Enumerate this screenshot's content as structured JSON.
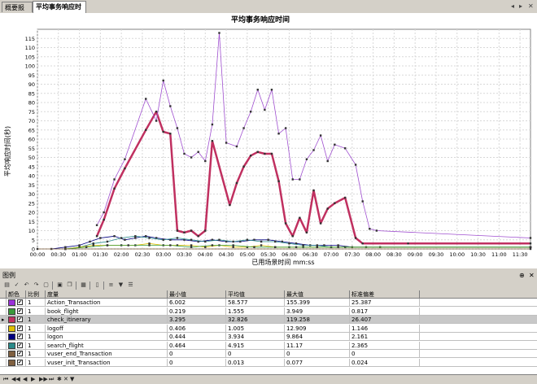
{
  "tabs": [
    {
      "label": "概要报告",
      "active": false
    },
    {
      "label": "平均事务响应时间",
      "active": true
    }
  ],
  "chart_data": {
    "type": "line",
    "title": "平均事务响应时间",
    "xlabel": "已用场景时间 mm:ss",
    "ylabel": "平均响应时间(秒)",
    "ylim": [
      0,
      120
    ],
    "xlim": [
      0,
      705
    ],
    "yticks": [
      0,
      5,
      10,
      15,
      20,
      25,
      30,
      35,
      40,
      45,
      50,
      55,
      60,
      65,
      70,
      75,
      80,
      85,
      90,
      95,
      100,
      105,
      110,
      115
    ],
    "xticks": [
      "00:00",
      "00:30",
      "01:00",
      "01:30",
      "02:00",
      "02:30",
      "03:00",
      "03:30",
      "04:00",
      "04:30",
      "05:00",
      "05:30",
      "06:00",
      "06:30",
      "07:00",
      "07:30",
      "08:00",
      "08:30",
      "09:00",
      "09:30",
      "10:00",
      "10:30",
      "11:00",
      "11:30"
    ],
    "grid": true,
    "series": [
      {
        "name": "check_itinerary",
        "color": "#c03060",
        "width": 2.5,
        "points": [
          [
            85,
            7
          ],
          [
            95,
            16
          ],
          [
            110,
            33
          ],
          [
            125,
            44
          ],
          [
            155,
            65
          ],
          [
            170,
            75
          ],
          [
            180,
            64
          ],
          [
            190,
            63
          ],
          [
            200,
            10
          ],
          [
            210,
            9
          ],
          [
            220,
            10
          ],
          [
            230,
            7
          ],
          [
            240,
            10
          ],
          [
            250,
            59
          ],
          [
            275,
            24
          ],
          [
            285,
            36
          ],
          [
            295,
            45
          ],
          [
            305,
            51
          ],
          [
            315,
            53
          ],
          [
            325,
            52
          ],
          [
            335,
            52
          ],
          [
            345,
            37
          ],
          [
            355,
            14
          ],
          [
            365,
            7
          ],
          [
            375,
            17
          ],
          [
            385,
            9
          ],
          [
            395,
            32
          ],
          [
            405,
            14
          ],
          [
            415,
            22
          ],
          [
            425,
            25
          ],
          [
            440,
            28
          ],
          [
            455,
            6
          ],
          [
            465,
            3
          ],
          [
            530,
            3
          ],
          [
            705,
            3
          ]
        ]
      },
      {
        "name": "Action_Transaction",
        "color": "#a050d0",
        "width": 0.8,
        "points": [
          [
            85,
            13
          ],
          [
            95,
            20
          ],
          [
            110,
            38
          ],
          [
            125,
            49
          ],
          [
            155,
            82
          ],
          [
            170,
            70
          ],
          [
            180,
            92
          ],
          [
            190,
            78
          ],
          [
            200,
            66
          ],
          [
            210,
            52
          ],
          [
            220,
            50
          ],
          [
            230,
            53
          ],
          [
            240,
            48
          ],
          [
            250,
            68
          ],
          [
            260,
            118
          ],
          [
            270,
            58
          ],
          [
            285,
            56
          ],
          [
            295,
            66
          ],
          [
            305,
            75
          ],
          [
            315,
            87
          ],
          [
            325,
            76
          ],
          [
            335,
            87
          ],
          [
            345,
            63
          ],
          [
            355,
            66
          ],
          [
            365,
            38
          ],
          [
            375,
            38
          ],
          [
            385,
            49
          ],
          [
            395,
            54
          ],
          [
            405,
            62
          ],
          [
            415,
            48
          ],
          [
            425,
            57
          ],
          [
            440,
            55
          ],
          [
            455,
            46
          ],
          [
            465,
            26
          ],
          [
            475,
            11
          ],
          [
            485,
            10
          ],
          [
            705,
            6
          ]
        ]
      },
      {
        "name": "logon",
        "color": "#000080",
        "width": 0.8,
        "points": [
          [
            20,
            0
          ],
          [
            40,
            1
          ],
          [
            60,
            2
          ],
          [
            75,
            4
          ],
          [
            90,
            6
          ],
          [
            110,
            7
          ],
          [
            125,
            5
          ],
          [
            140,
            6
          ],
          [
            155,
            7
          ],
          [
            170,
            6
          ],
          [
            190,
            5
          ],
          [
            210,
            5
          ],
          [
            230,
            4
          ],
          [
            250,
            5
          ],
          [
            270,
            4
          ],
          [
            290,
            4
          ],
          [
            310,
            5
          ],
          [
            330,
            5
          ],
          [
            350,
            4
          ],
          [
            370,
            3
          ],
          [
            390,
            2
          ],
          [
            410,
            2
          ],
          [
            430,
            2
          ],
          [
            450,
            1
          ],
          [
            470,
            1
          ],
          [
            490,
            1
          ],
          [
            705,
            1
          ]
        ]
      },
      {
        "name": "search_flight",
        "color": "#2a8a8a",
        "width": 0.8,
        "points": [
          [
            40,
            0
          ],
          [
            60,
            1
          ],
          [
            80,
            3
          ],
          [
            100,
            4
          ],
          [
            120,
            6
          ],
          [
            140,
            7
          ],
          [
            160,
            6
          ],
          [
            180,
            5
          ],
          [
            200,
            6
          ],
          [
            220,
            5
          ],
          [
            240,
            4
          ],
          [
            260,
            5
          ],
          [
            280,
            4
          ],
          [
            300,
            5
          ],
          [
            320,
            4
          ],
          [
            340,
            4
          ],
          [
            360,
            3
          ],
          [
            380,
            2
          ],
          [
            400,
            2
          ],
          [
            420,
            1
          ],
          [
            440,
            1
          ],
          [
            705,
            1
          ]
        ]
      },
      {
        "name": "logoff",
        "color": "#e0c000",
        "width": 0.8,
        "points": [
          [
            40,
            0
          ],
          [
            60,
            1
          ],
          [
            80,
            2
          ],
          [
            100,
            2
          ],
          [
            120,
            2
          ],
          [
            140,
            2
          ],
          [
            160,
            3
          ],
          [
            180,
            2
          ],
          [
            200,
            2
          ],
          [
            220,
            2
          ],
          [
            240,
            1
          ],
          [
            260,
            2
          ],
          [
            280,
            1
          ],
          [
            300,
            1
          ],
          [
            320,
            2
          ],
          [
            340,
            1
          ],
          [
            360,
            1
          ],
          [
            380,
            1
          ],
          [
            400,
            1
          ],
          [
            420,
            1
          ],
          [
            440,
            1
          ],
          [
            705,
            1
          ]
        ]
      },
      {
        "name": "book_flight",
        "color": "#3a9a3a",
        "width": 0.8,
        "points": [
          [
            40,
            0
          ],
          [
            70,
            1
          ],
          [
            100,
            2
          ],
          [
            130,
            2
          ],
          [
            160,
            2
          ],
          [
            190,
            2
          ],
          [
            220,
            1
          ],
          [
            250,
            2
          ],
          [
            280,
            2
          ],
          [
            310,
            1
          ],
          [
            340,
            1
          ],
          [
            370,
            1
          ],
          [
            400,
            1
          ],
          [
            430,
            1
          ],
          [
            705,
            1
          ]
        ]
      },
      {
        "name": "vuser_end_Transaction",
        "color": "#806040",
        "width": 0.8,
        "points": [
          [
            0,
            0
          ],
          [
            705,
            0
          ]
        ]
      }
    ]
  },
  "legend": {
    "title": "图例",
    "columns": [
      "颜色",
      "比例",
      "度量",
      "最小值",
      "平均值",
      "最大值",
      "标准偏差"
    ],
    "rows": [
      {
        "color": "#9b30d9",
        "scale": "1",
        "measure": "Action_Transaction",
        "min": "6.002",
        "avg": "58.577",
        "max": "155.399",
        "std": "25.387",
        "selected": false
      },
      {
        "color": "#3a9a3a",
        "scale": "1",
        "measure": "book_flight",
        "min": "0.219",
        "avg": "1.555",
        "max": "3.949",
        "std": "0.817",
        "selected": false
      },
      {
        "color": "#c03060",
        "scale": "1",
        "measure": "check_itinerary",
        "min": "3.295",
        "avg": "32.826",
        "max": "119.258",
        "std": "26.407",
        "selected": true
      },
      {
        "color": "#e0c000",
        "scale": "1",
        "measure": "logoff",
        "min": "0.406",
        "avg": "1.005",
        "max": "12.909",
        "std": "1.146",
        "selected": false
      },
      {
        "color": "#000080",
        "scale": "1",
        "measure": "logon",
        "min": "0.444",
        "avg": "3.934",
        "max": "9.864",
        "std": "2.161",
        "selected": false
      },
      {
        "color": "#2a8a8a",
        "scale": "1",
        "measure": "search_flight",
        "min": "0.464",
        "avg": "4.915",
        "max": "11.17",
        "std": "2.365",
        "selected": false
      },
      {
        "color": "#806040",
        "scale": "1",
        "measure": "vuser_end_Transaction",
        "min": "0",
        "avg": "0",
        "max": "0",
        "std": "0",
        "selected": false
      },
      {
        "color": "#806040",
        "scale": "1",
        "measure": "vuser_init_Transaction",
        "min": "0",
        "avg": "0.013",
        "max": "0.077",
        "std": "0.024",
        "selected": false
      }
    ]
  }
}
